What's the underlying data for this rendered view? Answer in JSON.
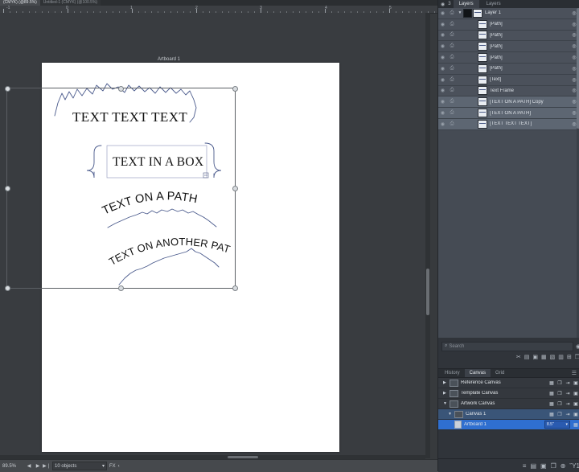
{
  "document_tabs": [
    {
      "label": "(CMYK) (@89.5%)",
      "active": true
    },
    {
      "label": "Untitled-1 (CMYK) (@100.5%)",
      "active": false
    }
  ],
  "ruler": {
    "unit_marks": [
      "-1",
      "0",
      "1",
      "2",
      "3",
      "4",
      "5"
    ]
  },
  "canvas": {
    "artboard_label": "Artboard 1",
    "artwork": {
      "text_1": "TEXT TEXT TEXT",
      "text_2": "TEXT IN A BOX",
      "text_3": "TEXT ON A PATH",
      "text_4": "TEXT ON ANOTHER PATH",
      "stroke_color": "#4a5a8c",
      "text_color": "#1a1a1a"
    }
  },
  "statusbar": {
    "zoom": "89.5%",
    "nav_first": "◀",
    "nav_prev": "▶",
    "nav_next": "▶❘",
    "object_count": "10 objects",
    "dropdown_caret": "▾",
    "fx_label": "FX",
    "chevron": "‹"
  },
  "panel_tabs": {
    "icon_left": "◉",
    "icon_count": "3",
    "tabs": [
      {
        "label": "Layers",
        "active": true
      },
      {
        "label": "Layers",
        "active": false
      }
    ]
  },
  "layers": {
    "items": [
      {
        "name": "Layer 1",
        "depth": 0,
        "selected": false,
        "has_expander": true,
        "has_swatch": true
      },
      {
        "name": "[Path]",
        "depth": 1,
        "selected": false,
        "has_expander": false,
        "has_swatch": false
      },
      {
        "name": "[Path]",
        "depth": 1,
        "selected": false,
        "has_expander": false,
        "has_swatch": false
      },
      {
        "name": "[Path]",
        "depth": 1,
        "selected": false,
        "has_expander": false,
        "has_swatch": false
      },
      {
        "name": "[Path]",
        "depth": 1,
        "selected": false,
        "has_expander": false,
        "has_swatch": false
      },
      {
        "name": "[Path]",
        "depth": 1,
        "selected": false,
        "has_expander": false,
        "has_swatch": false
      },
      {
        "name": "[Text]",
        "depth": 1,
        "selected": false,
        "has_expander": false,
        "has_swatch": false
      },
      {
        "name": "Text Frame",
        "depth": 1,
        "selected": false,
        "has_expander": false,
        "has_swatch": false
      },
      {
        "name": "[TEXT ON A PATH] Copy",
        "depth": 1,
        "selected": true,
        "has_expander": false,
        "has_swatch": false
      },
      {
        "name": "[TEXT ON A PATH]",
        "depth": 1,
        "selected": true,
        "has_expander": false,
        "has_swatch": false
      },
      {
        "name": "[TEXT TEXT TEXT]",
        "depth": 1,
        "selected": true,
        "has_expander": false,
        "has_swatch": false
      }
    ],
    "eye_icon": "◉",
    "lock_icon": "⎙",
    "target_icon": "◎",
    "expander_icon": "▼"
  },
  "search": {
    "placeholder": "Search",
    "icon": "⌕",
    "right_icon": "◉"
  },
  "layers_footer": {
    "icons": [
      "✂",
      "▤",
      "▣",
      "▦",
      "▧",
      "▥",
      "⊞",
      "❐"
    ]
  },
  "canvas_panel": {
    "tabs": [
      {
        "label": "History",
        "active": false
      },
      {
        "label": "Canvas",
        "active": true
      },
      {
        "label": "Grid",
        "active": false
      }
    ],
    "menu_icon": "☰",
    "rows": [
      {
        "name": "Reference Canvas",
        "expander": "▶",
        "type": "group",
        "selected": false,
        "sub": false
      },
      {
        "name": "Template Canvas",
        "expander": "▶",
        "type": "group",
        "selected": false,
        "sub": false
      },
      {
        "name": "Artwork Canvas",
        "expander": "▼",
        "type": "group",
        "selected": false,
        "sub": false
      },
      {
        "name": "Canvas 1",
        "expander": "▼",
        "type": "canvas",
        "selected": false,
        "sub": true
      },
      {
        "name": "Artboard 1",
        "expander": "",
        "type": "artboard",
        "selected": true,
        "sub": true,
        "size_value": "8.5\""
      }
    ],
    "row_icons": [
      "▦",
      "❐",
      "⇥",
      "▣"
    ]
  },
  "right_footer": {
    "icons": [
      "≡",
      "▤",
      "▣",
      "❐",
      "⊕",
      "Ὕ1"
    ]
  },
  "colors": {
    "panel_bg": "#30343a",
    "layer_row": "#4b515b",
    "layer_selected": "#5d6672",
    "canvas_selected": "#2f6fd0",
    "workspace": "#393c40",
    "artboard": "#ffffff"
  }
}
